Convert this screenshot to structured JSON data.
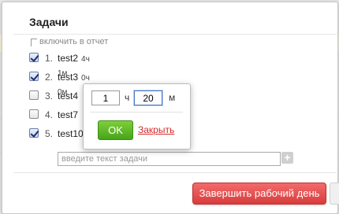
{
  "dialog": {
    "title": "Задачи",
    "report_label": "включить в отчет"
  },
  "tasks": [
    {
      "num": "1.",
      "name": "test2",
      "time": "4ч 1м",
      "checked": true
    },
    {
      "num": "2.",
      "name": "test3",
      "time": "0ч 0м",
      "checked": true
    },
    {
      "num": "3.",
      "name": "test4",
      "time": "",
      "checked": false
    },
    {
      "num": "4.",
      "name": "test7",
      "time": "",
      "checked": false
    },
    {
      "num": "5.",
      "name": "test10",
      "time": "",
      "checked": true
    }
  ],
  "new_task": {
    "placeholder": "введите текст задачи",
    "add_icon": "plus-icon"
  },
  "time_popup": {
    "hours_value": "1",
    "hours_unit": "ч",
    "minutes_value": "20",
    "minutes_unit": "м",
    "ok_label": "OK",
    "close_label": "Закрыть"
  },
  "footer": {
    "finish_label": "Завершить рабочий день"
  },
  "colors": {
    "accent_red": "#e04848",
    "ok_green": "#56b024",
    "link_red": "#d42a2a"
  }
}
